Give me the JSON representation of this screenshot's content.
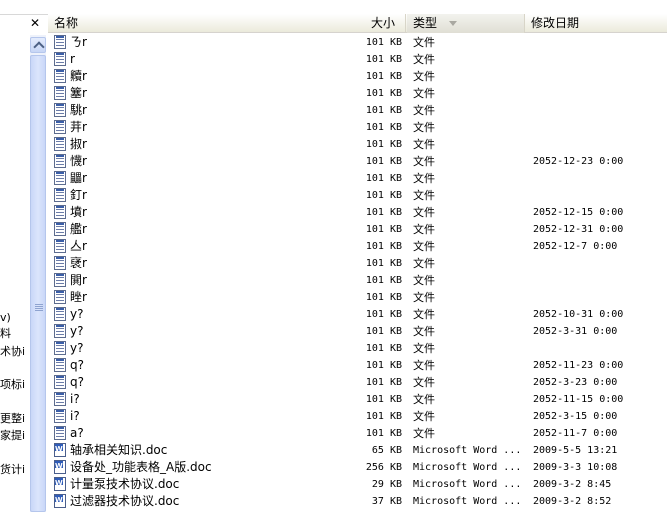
{
  "left_pane": {
    "fragments": [
      "v)",
      "料",
      "术协i",
      "项标i",
      "更整i",
      "家提i",
      "货计i"
    ]
  },
  "close_button": {
    "glyph": "✕"
  },
  "header": {
    "name": "名称",
    "size": "大小",
    "type": "类型",
    "date": "修改日期"
  },
  "rows": [
    {
      "name": "ㄋr",
      "size": "101 KB",
      "type": "文件",
      "date": "",
      "icon": "file-icon"
    },
    {
      "name": " r",
      "size": "101 KB",
      "type": "文件",
      "date": "",
      "icon": "file-icon"
    },
    {
      "name": "贕r",
      "size": "101 KB",
      "type": "文件",
      "date": "",
      "icon": "file-icon"
    },
    {
      "name": "簺r",
      "size": "101 KB",
      "type": "文件",
      "date": "",
      "icon": "file-icon"
    },
    {
      "name": "駣r",
      "size": "101 KB",
      "type": "文件",
      "date": "",
      "icon": "file-icon"
    },
    {
      "name": "茾r",
      "size": "101 KB",
      "type": "文件",
      "date": "",
      "icon": "file-icon"
    },
    {
      "name": "掓r",
      "size": "101 KB",
      "type": "文件",
      "date": "",
      "icon": "file-icon"
    },
    {
      "name": "懱r",
      "size": "101 KB",
      "type": "文件",
      "date": "2052-12-23 0:00",
      "icon": "file-icon"
    },
    {
      "name": "鼺r",
      "size": "101 KB",
      "type": "文件",
      "date": "",
      "icon": "file-icon"
    },
    {
      "name": "釘r",
      "size": "101 KB",
      "type": "文件",
      "date": "",
      "icon": "file-icon"
    },
    {
      "name": "墳r",
      "size": "101 KB",
      "type": "文件",
      "date": "2052-12-15 0:00",
      "icon": "file-icon"
    },
    {
      "name": "艦r",
      "size": "101 KB",
      "type": "文件",
      "date": "2052-12-31 0:00",
      "icon": "file-icon"
    },
    {
      "name": "亼r",
      "size": "101 KB",
      "type": "文件",
      "date": "2052-12-7 0:00",
      "icon": "file-icon"
    },
    {
      "name": "裦r",
      "size": "101 KB",
      "type": "文件",
      "date": "",
      "icon": "file-icon"
    },
    {
      "name": "閧r",
      "size": "101 KB",
      "type": "文件",
      "date": "",
      "icon": "file-icon"
    },
    {
      "name": "睉r",
      "size": "101 KB",
      "type": "文件",
      "date": "",
      "icon": "file-icon"
    },
    {
      "name": "y?",
      "size": "101 KB",
      "type": "文件",
      "date": "2052-10-31 0:00",
      "icon": "file-icon"
    },
    {
      "name": "y?",
      "size": "101 KB",
      "type": "文件",
      "date": "2052-3-31 0:00",
      "icon": "file-icon"
    },
    {
      "name": "y?",
      "size": "101 KB",
      "type": "文件",
      "date": "",
      "icon": "file-icon"
    },
    {
      "name": "q?",
      "size": "101 KB",
      "type": "文件",
      "date": "2052-11-23 0:00",
      "icon": "file-icon"
    },
    {
      "name": "q?",
      "size": "101 KB",
      "type": "文件",
      "date": "2052-3-23 0:00",
      "icon": "file-icon"
    },
    {
      "name": "i?",
      "size": "101 KB",
      "type": "文件",
      "date": "2052-11-15 0:00",
      "icon": "file-icon"
    },
    {
      "name": "i?",
      "size": "101 KB",
      "type": "文件",
      "date": "2052-3-15 0:00",
      "icon": "file-icon"
    },
    {
      "name": "a?",
      "size": "101 KB",
      "type": "文件",
      "date": "2052-11-7 0:00",
      "icon": "file-icon"
    },
    {
      "name": "轴承相关知识.doc",
      "size": "65 KB",
      "type": "Microsoft Word ...",
      "date": "2009-5-5 13:21",
      "icon": "word-doc-icon"
    },
    {
      "name": "设备处_功能表格_A版.doc",
      "size": "256 KB",
      "type": "Microsoft Word ...",
      "date": "2009-3-3 10:08",
      "icon": "word-doc-icon"
    },
    {
      "name": "计量泵技术协议.doc",
      "size": "29 KB",
      "type": "Microsoft Word ...",
      "date": "2009-3-2 8:45",
      "icon": "word-doc-icon"
    },
    {
      "name": "过滤器技术协议.doc",
      "size": "37 KB",
      "type": "Microsoft Word ...",
      "date": "2009-3-2 8:52",
      "icon": "word-doc-icon"
    }
  ]
}
